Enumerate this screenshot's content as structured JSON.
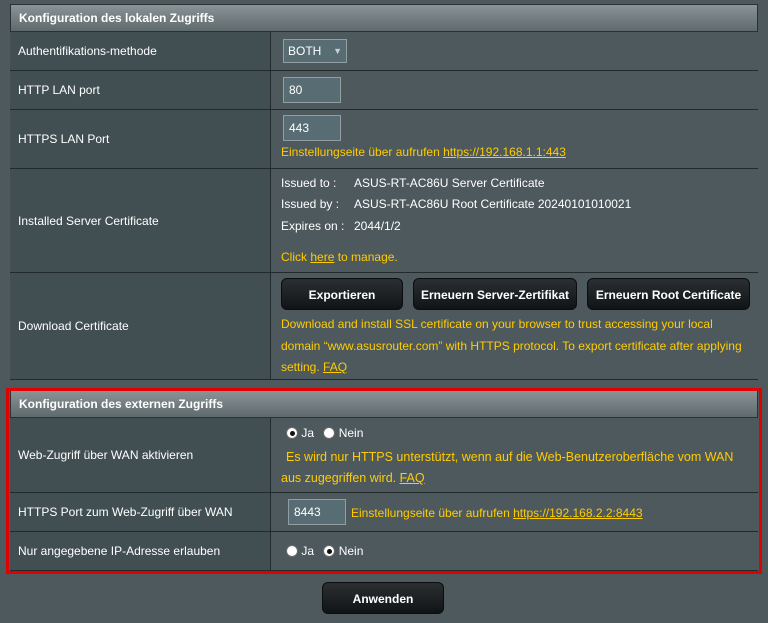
{
  "local": {
    "title": "Konfiguration des lokalen Zugriffs",
    "auth_label": "Authentifikations-methode",
    "auth_value": "BOTH",
    "http_label": "HTTP LAN port",
    "http_value": "80",
    "https_label": "HTTPS LAN Port",
    "https_value": "443",
    "https_hint_prefix": "Einstellungseite über aufrufen ",
    "https_hint_link": "https://192.168.1.1:443",
    "cert_label": "Installed Server Certificate",
    "issued_to_key": "Issued to :",
    "issued_to_val": "ASUS-RT-AC86U Server Certificate",
    "issued_by_key": "Issued by :",
    "issued_by_val": "ASUS-RT-AC86U Root Certificate 20240101010021",
    "expires_key": "Expires on :",
    "expires_val": "2044/1/2",
    "manage_prefix": "Click ",
    "manage_link": "here",
    "manage_suffix": " to manage.",
    "download_label": "Download Certificate",
    "btn_export": "Exportieren",
    "btn_renew_server": "Erneuern Server-Zertifikat",
    "btn_renew_root": "Erneuern Root Certificate",
    "download_desc_1": "Download and install SSL certificate on your browser to trust accessing your local",
    "download_desc_2": "domain “www.asusrouter.com” with HTTPS protocol. To export certificate after applying",
    "download_desc_3": "setting. ",
    "faq": "FAQ"
  },
  "external": {
    "title": "Konfiguration des externen Zugriffs",
    "wan_label": "Web-Zugriff über WAN aktivieren",
    "yes": "Ja",
    "no": "Nein",
    "wan_note_1": "Es wird nur HTTPS unterstützt, wenn auf die Web-Benutzeroberfläche vom WAN",
    "wan_note_2": "aus zugegriffen wird. ",
    "faq": "FAQ",
    "port_label": "HTTPS Port zum Web-Zugriff über WAN",
    "port_value": "8443",
    "port_hint_prefix": "Einstellungseite über aufrufen ",
    "port_hint_link": "https://192.168.2.2:8443",
    "ip_label": "Nur angegebene IP-Adresse erlauben"
  },
  "apply_label": "Anwenden",
  "colors": {
    "accent": "#ffcc00",
    "highlight_border": "#e00000"
  }
}
